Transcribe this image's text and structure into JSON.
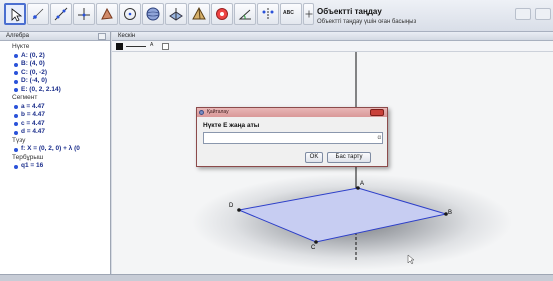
{
  "toolbar": {
    "title": "Объектті таңдау",
    "subtitle": "Объектті таңдау үшін оған басыңыз",
    "tools": [
      {
        "icon": "move-arrow-icon"
      },
      {
        "icon": "point-icon"
      },
      {
        "icon": "line-icon"
      },
      {
        "icon": "perpendicular-line-icon"
      },
      {
        "icon": "polygon-icon"
      },
      {
        "icon": "circle-icon"
      },
      {
        "icon": "sphere-icon"
      },
      {
        "icon": "intersect-planes-icon"
      },
      {
        "icon": "pyramid-icon"
      },
      {
        "icon": "rotate-view-icon"
      },
      {
        "icon": "angle-icon"
      },
      {
        "icon": "reflect-icon"
      },
      {
        "icon": "text-icon",
        "label": "ABC"
      },
      {
        "icon": "move-graphics-view-icon"
      }
    ]
  },
  "algebra": {
    "title": "Алгебра",
    "sections": [
      {
        "label": "Нүкте",
        "items": [
          "A: (0, 2)",
          "B: (4, 0)",
          "C: (0, -2)",
          "D: (-4, 0)",
          "E: (0, 2, 2.14)"
        ]
      },
      {
        "label": "Сегмент",
        "items": [
          "a = 4.47",
          "b = 4.47",
          "c = 4.47",
          "d = 4.47"
        ]
      },
      {
        "label": "Түзу",
        "items": [
          "f: X = (0, 2, 0) + λ (0"
        ]
      },
      {
        "label": "Тербұрыш",
        "items": [
          "q1 = 16"
        ]
      }
    ]
  },
  "graphics": {
    "title": "Кескін",
    "points": [
      "A",
      "B",
      "C",
      "D"
    ],
    "colors": {
      "polygon_fill": "#c7cdf2",
      "polygon_stroke": "#2d3fc9",
      "point": "#1a1a1a"
    }
  },
  "dialog": {
    "title": "Қайталау",
    "prompt": "Нүкте E жаңа аты",
    "input_value": "",
    "input_button": "α",
    "ok": "OK",
    "cancel": "Бас тарту"
  },
  "colors": {
    "accent": "#2a52d9",
    "dialog_border": "#8c4b4b",
    "dialog_close": "#c9413a"
  }
}
